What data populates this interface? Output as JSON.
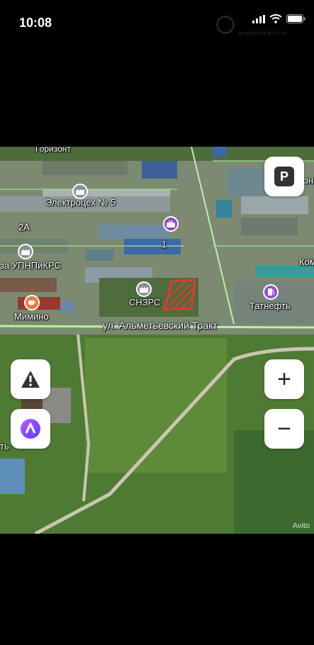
{
  "status_bar": {
    "time": "10:08",
    "watermark": "недвижимость"
  },
  "map": {
    "labels": {
      "gorizont": "Горизонт",
      "electro": "Электроцех № 5",
      "num_2a": "2А",
      "num_1": "1",
      "upnp": "за УПНПиКРС",
      "sn3rs": "СНЗРС",
      "mimino": "Мимино",
      "tatneft": "Татнефть",
      "kom": "Ком",
      "zna": "зна",
      "t_edge": "ть",
      "road": "ул. Альметьевский Тракт"
    },
    "controls": {
      "parking_label": "P",
      "zoom_in_label": "+",
      "zoom_out_label": "−"
    },
    "watermark": "Avito"
  }
}
